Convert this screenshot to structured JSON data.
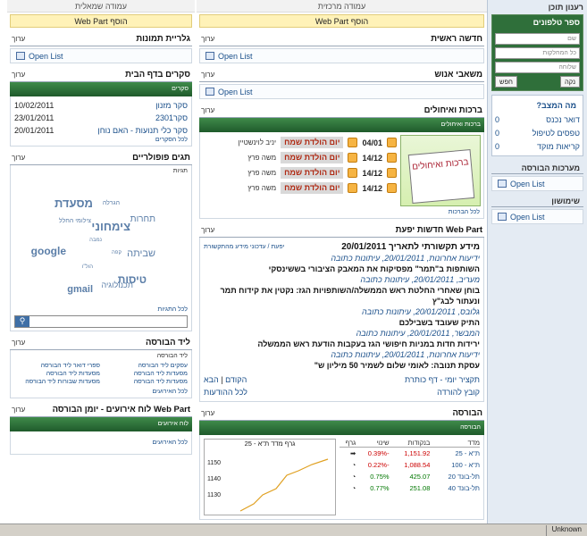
{
  "right": {
    "title": "רענון תוכן",
    "phone": {
      "title": "ספר טלפונים",
      "ph1": "שם",
      "ph2": "כל המחלקות",
      "ph3": "שלוחה",
      "search": "חפש",
      "clear": "נקה"
    },
    "state": {
      "title": "מה המצב?",
      "rows": [
        {
          "label": "דואר נכנס",
          "val": "0"
        },
        {
          "label": "טפסים לטיפול",
          "val": "0"
        },
        {
          "label": "קריאות מוקד",
          "val": "0"
        }
      ]
    },
    "bourse_title": "מערכות הבורסה",
    "open1": "Open List",
    "shimushon": "שימושון",
    "open2": "Open List"
  },
  "mid": {
    "colhdr": "עמודה מרכזית",
    "addwp": "הוסף Web Part",
    "main_news": {
      "title": "חדשה ראשית",
      "menu": "ערוך",
      "open": "Open List"
    },
    "hr": {
      "title": "משאבי אנוש",
      "menu": "ערוך",
      "open": "Open List"
    },
    "greet": {
      "title": "ברכות ואיחולים",
      "menu": "ערוך",
      "bar": "ברכות ואיחולים",
      "card": "ברכות ואיחולים",
      "more": "לכל הברכות",
      "rows": [
        {
          "date": "04/01",
          "type": "יום הולדת שמח",
          "name": "יניב לוינשטיין"
        },
        {
          "date": "14/12",
          "type": "יום הולדת שמח",
          "name": "משה פרץ"
        },
        {
          "date": "14/12",
          "type": "יום הולדת שמח",
          "name": "משה פרץ"
        },
        {
          "date": "14/12",
          "type": "יום הולדת שמח",
          "name": "משה פרץ"
        }
      ]
    },
    "news": {
      "title": "Web Part חדשות יפעת",
      "menu": "ערוך",
      "headline": "מידע תקשורתי לתאריך 20/01/2011",
      "sub": "יפעת / עדכוני מידע מהתקשורת",
      "items": [
        {
          "src": "ידיעות אחרונות, 20/01/2011, עיתונות כתובה",
          "hd": "השותפות ב\"תמר\" מפסיקות את המאבק הציבורי בששינסקי"
        },
        {
          "src": "מעריב, 20/01/2011, עיתונות כתובה",
          "hd": "בוחן שאחרי החלטת ראש הממשלה/השותפויות הגז: נקטין את קידוח תמר ונעתור לבג\"ץ"
        },
        {
          "src": "גלובס, 20/01/2011, עיתונות כתובה",
          "hd": "התיק שעובד בשבילכם"
        },
        {
          "src": "המבשר, 20/01/2011, עיתונות כתובה",
          "hd": "ירידות חדות במניות חיפושי הגז בעקבות הודעת ראש הממשלה"
        },
        {
          "src": "ידיעות אחרונות, 20/01/2011, עיתונות כתובה",
          "hd": "עסקת תנובה: לאומי שלום לשמיר 50 מיליון ש\""
        }
      ],
      "daily": "תקציר יומי - דף כותרת",
      "next": "הבא",
      "prev": "הקודם",
      "digest": "קובץ להורדה",
      "all": "לכל ההודעות"
    },
    "bourse": {
      "title": "הבורסה",
      "menu": "ערוך",
      "bar": "הבורסה",
      "graph_title": "גרף מדד ת\"א - 25",
      "yticks": [
        "1150",
        "1140",
        "1130"
      ],
      "cols": [
        "מדד",
        "בנקודות",
        "שינוי",
        "גרף"
      ],
      "rows": [
        {
          "name": "ת\"א - 25",
          "pts": "1,151.92",
          "chg": "-0.39%"
        },
        {
          "name": "ת\"א - 100",
          "pts": "1,088.54",
          "chg": "-0.22%"
        },
        {
          "name": "תל-בונד 20",
          "pts": "425.07",
          "chg": "0.75%"
        },
        {
          "name": "תל-בונד 40",
          "pts": "251.08",
          "chg": "0.77%"
        }
      ]
    }
  },
  "left": {
    "colhdr": "עמודה שמאלית",
    "addwp": "הוסף Web Part",
    "gallery": {
      "title": "גלריית תמונות",
      "menu": "ערוך",
      "open": "Open List"
    },
    "surveys": {
      "title": "סקרים בדף הבית",
      "menu": "ערוך",
      "bar": "סקרים",
      "rows": [
        {
          "name": "סקר מזנון",
          "date": "10/02/2011"
        },
        {
          "name": "סקר2301",
          "date": "23/01/2011"
        },
        {
          "name": "סקר כלי תנועות - האם נוחן",
          "date": "20/01/2011"
        }
      ],
      "more": "לכל הסקרים"
    },
    "tags": {
      "title": "תגים פופולריים",
      "menu": "ערוך",
      "bar": "תגיות",
      "more": "לכל התגיות",
      "list": [
        "מסעדת",
        "הגרלה",
        "תחרות",
        "צימחוני",
        "צילומי החלל",
        "google",
        "שביתה",
        "טיסות",
        "תכנולוגיה",
        "gmail",
        "נמבה",
        "קפה",
        "הול\"ו"
      ]
    },
    "lead": {
      "title": "ליד הבורסה",
      "menu": "ערוך",
      "bar": "ליד הבורסה",
      "links": [
        "עסקים ליד הבורסה",
        "מסעדות ליד הבורסה",
        "מסעדות ליד הבורסה",
        "ספרי דואר ליד הבורסה",
        "מסעדות שבורות ליד הבורסה",
        "מסעדות ליד הבורסה"
      ],
      "more": "לכל האירועים"
    },
    "events": {
      "title": "Web Part לוח אירועים - יומן הבורסה",
      "menu": "ערוך",
      "bar": "לוח אירועים",
      "more": "לכל האירועים"
    }
  },
  "status": {
    "zone": "Unknown"
  }
}
